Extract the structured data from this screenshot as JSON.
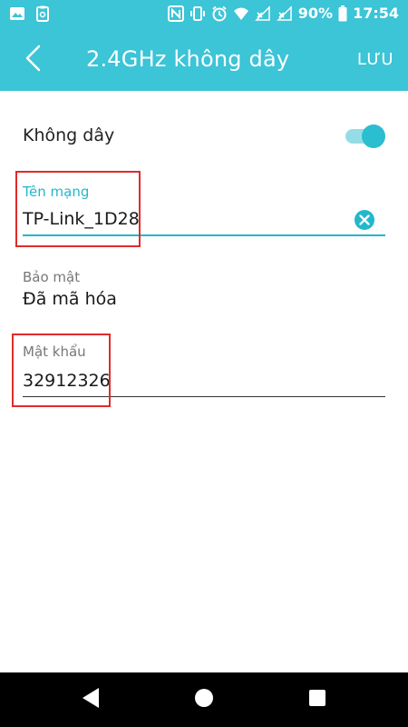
{
  "status_bar": {
    "battery": "90%",
    "time": "17:54",
    "icons_left": [
      "image-icon",
      "clipboard-icon"
    ],
    "icons_right": [
      "nfc-icon",
      "vibrate-icon",
      "alarm-icon",
      "wifi-icon",
      "signal-icon",
      "signal-icon",
      "battery-icon"
    ]
  },
  "app_bar": {
    "title": "2.4GHz không dây",
    "save_label": "LƯU",
    "back_icon": "chevron-left-icon"
  },
  "wireless": {
    "label": "Không dây",
    "enabled": true
  },
  "network_name": {
    "label": "Tên mạng",
    "value": "TP-Link_1D28",
    "clear_icon": "clear-icon"
  },
  "security": {
    "label": "Bảo mật",
    "value": "Đã mã hóa"
  },
  "password": {
    "label": "Mật khẩu",
    "value": "32912326"
  },
  "colors": {
    "accent": "#3cc4d7",
    "accent_dark": "#22b8cc",
    "highlight": "#e02b2b"
  }
}
